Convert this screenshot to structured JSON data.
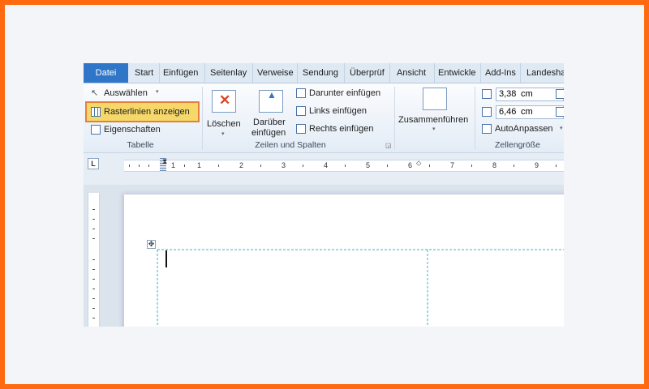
{
  "tabs": [
    {
      "label": "Datei"
    },
    {
      "label": "Start"
    },
    {
      "label": "Einfügen"
    },
    {
      "label": "Seitenlay"
    },
    {
      "label": "Verweise"
    },
    {
      "label": "Sendung"
    },
    {
      "label": "Überprüf"
    },
    {
      "label": "Ansicht"
    },
    {
      "label": "Entwickle"
    },
    {
      "label": "Add-Ins"
    },
    {
      "label": "Landesha"
    }
  ],
  "ribbon": {
    "tabelle": {
      "auswaehlen": "Auswählen",
      "rasterlinien": "Rasterlinien anzeigen",
      "eigenschaften": "Eigenschaften",
      "label": "Tabelle"
    },
    "loeschen": {
      "label": "Löschen"
    },
    "zeilen_spalten": {
      "darueber_line1": "Darüber",
      "darueber_line2": "einfügen",
      "darunter": "Darunter einfügen",
      "links": "Links einfügen",
      "rechts": "Rechts einfügen",
      "label": "Zeilen und Spalten"
    },
    "zusammenfuehren": {
      "label": "Zusammenführen"
    },
    "zellengroesse": {
      "height_value": "3,38",
      "height_unit": "cm",
      "width_value": "6,46",
      "width_unit": "cm",
      "autoanpassen": "AutoAnpassen",
      "label": "Zellengröße"
    }
  },
  "ruler": {
    "tab_selector": "L",
    "numbers": [
      "1",
      "1",
      "2",
      "3",
      "4",
      "5",
      "6",
      "7",
      "8",
      "9"
    ]
  },
  "colors": {
    "frame": "#ff6a10",
    "datei_tab": "#2f76c9",
    "highlight_fill": "#f6d86a",
    "highlight_border": "#e2823a",
    "gridline": "#3fb0c2"
  }
}
